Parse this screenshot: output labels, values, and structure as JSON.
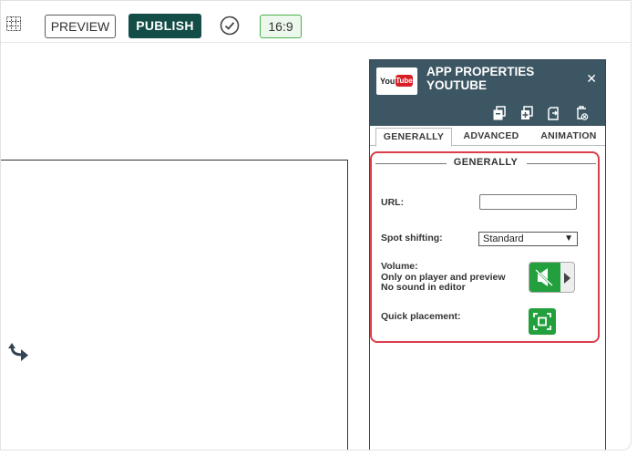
{
  "toolbar": {
    "preview_label": "PREVIEW",
    "publish_label": "PUBLISH",
    "ratio_label": "16:9"
  },
  "panel": {
    "logo": {
      "you": "You",
      "tube": "Tube"
    },
    "title_line1": "APP PROPERTIES",
    "title_line2": "YOUTUBE",
    "close_label": "✕",
    "tabs": [
      {
        "label": "GENERALLY",
        "active": true
      },
      {
        "label": "ADVANCED",
        "active": false
      },
      {
        "label": "ANIMATION",
        "active": false
      }
    ],
    "section": {
      "title": "GENERALLY",
      "url_label": "URL:",
      "url_value": "",
      "spot_label": "Spot shifting:",
      "spot_value": "Standard",
      "volume_line1": "Volume:",
      "volume_line2": "Only on player and preview",
      "volume_line3": "No sound in editor",
      "quick_label": "Quick placement:"
    }
  },
  "colors": {
    "publish_bg": "#124d48",
    "panel_header": "#3c5663",
    "highlight": "#d93f48",
    "green": "#23a03d"
  }
}
